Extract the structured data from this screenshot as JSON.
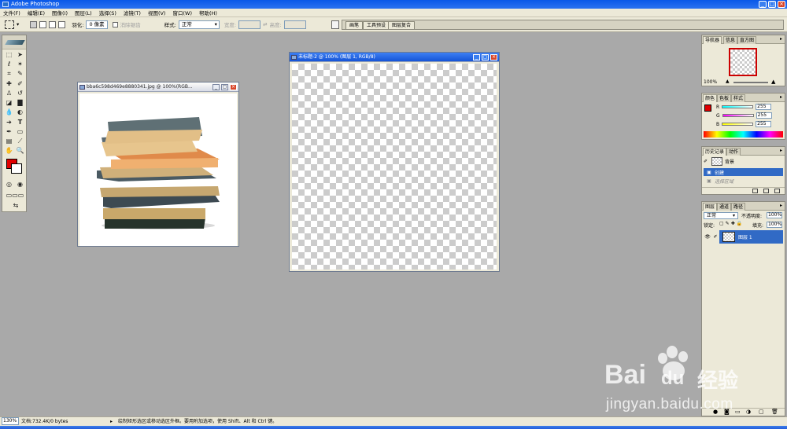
{
  "app": {
    "title": "Adobe Photoshop"
  },
  "menu": [
    "文件(F)",
    "编辑(E)",
    "图像(I)",
    "图层(L)",
    "选择(S)",
    "滤镜(T)",
    "视图(V)",
    "窗口(W)",
    "帮助(H)"
  ],
  "options": {
    "feather_label": "羽化:",
    "feather_value": "0 像素",
    "antialias_label": "消除锯齿",
    "style_label": "样式:",
    "style_value": "正常",
    "width_label": "宽度:",
    "height_label": "高度:"
  },
  "palette_well": [
    "画笔",
    "工具预设",
    "图层复合"
  ],
  "doc1": {
    "title": "bba6c598d469e8880341.jpg @ 100%(RGB..."
  },
  "doc2": {
    "title": "未标题-2 @ 100% (图层 1, RGB/8)"
  },
  "navigator": {
    "tabs": [
      "导航器",
      "信息",
      "直方图"
    ],
    "zoom": "100%"
  },
  "color": {
    "tabs": [
      "颜色",
      "色板",
      "样式"
    ],
    "r": "R",
    "g": "G",
    "b": "B",
    "r_val": "255",
    "g_val": "255",
    "b_val": "255",
    "foreground": "#e00000"
  },
  "history": {
    "tabs": [
      "历史记录",
      "动作"
    ],
    "snapshot": "背景",
    "items": [
      "创建",
      "选择区域"
    ]
  },
  "layers": {
    "tabs": [
      "图层",
      "通道",
      "路径"
    ],
    "mode": "正常",
    "opacity_label": "不透明度:",
    "opacity": "100%",
    "lock_label": "锁定:",
    "fill_label": "填充:",
    "fill": "100%",
    "layer_name": "图层 1"
  },
  "status": {
    "zoom": "130%",
    "doc_size": "文档:732.4K/0 bytes",
    "hint": "绘制矩形选区或移动选区外框。要用附加选项，使用 Shift、Alt 和 Ctrl 键。"
  },
  "watermark": {
    "brand1": "Bai",
    "brand2": "du",
    "cn": "经验",
    "url": "jingyan.baidu.com"
  }
}
